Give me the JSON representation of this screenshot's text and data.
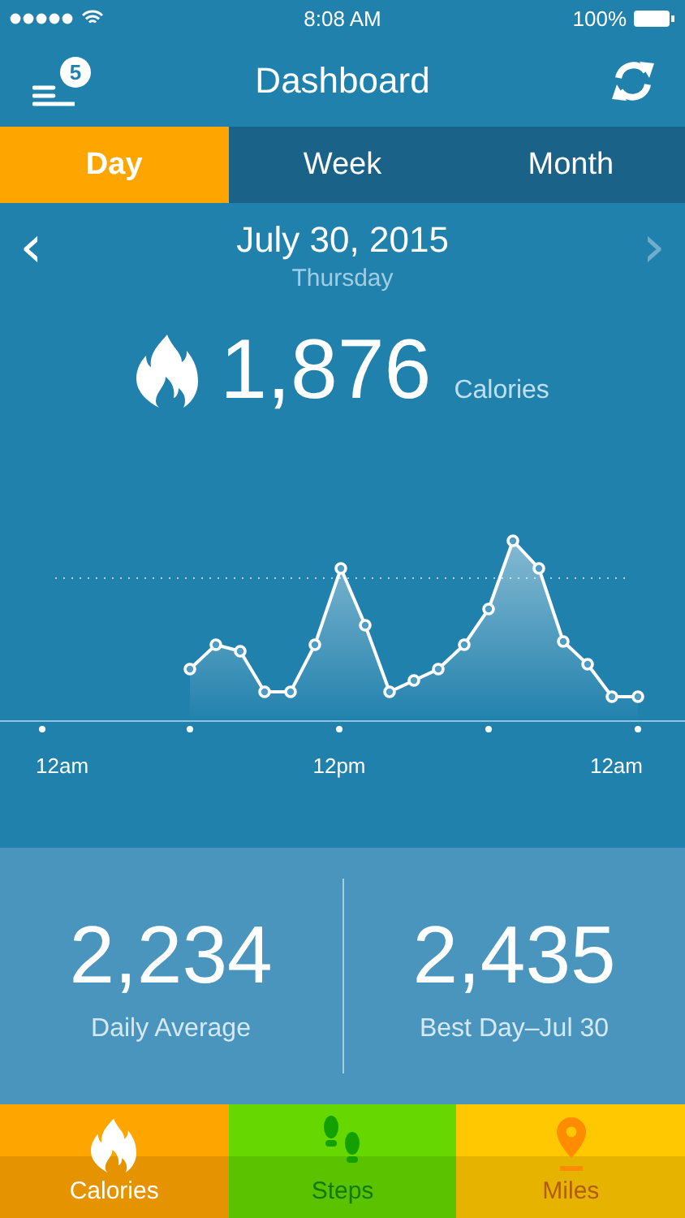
{
  "status_bar": {
    "time": "8:08 AM",
    "battery": "100%"
  },
  "header": {
    "title": "Dashboard",
    "badge": "5"
  },
  "tabs": [
    {
      "label": "Day",
      "selected": true
    },
    {
      "label": "Week",
      "selected": false
    },
    {
      "label": "Month",
      "selected": false
    }
  ],
  "date": {
    "prev": "‹",
    "date": "July 30, 2015",
    "weekday": "Thursday",
    "next": "›",
    "next_disabled": true
  },
  "total": {
    "value": "1,876",
    "unit": "Calories"
  },
  "chart": {
    "x_labels": [
      "12am",
      "12pm",
      "12am"
    ]
  },
  "stats": [
    {
      "value": "2,234",
      "label": "Daily Average"
    },
    {
      "value": "2,435",
      "label": "Best Day–Jul 30"
    }
  ],
  "bottom_tabs": [
    {
      "kind": "flame",
      "label": "Calories",
      "color": "#ffa500"
    },
    {
      "kind": "steps",
      "label": "Steps",
      "color": "#66d800"
    },
    {
      "kind": "pin",
      "label": "Miles",
      "color": "#ffc800"
    }
  ]
}
